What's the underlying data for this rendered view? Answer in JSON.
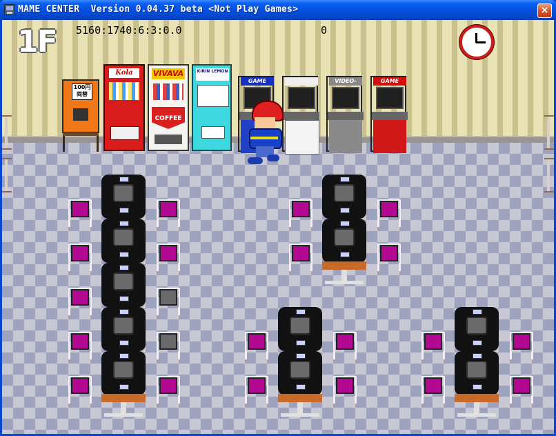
{
  "window": {
    "title": "MAME CENTER  Version 0.04.37 beta <Not Play Games>",
    "close_glyph": "×"
  },
  "hud": {
    "floor": "1F",
    "stats": "5160:1740:6:3:0.0",
    "score": "0"
  },
  "machines": {
    "coin_changer": {
      "price": "100円",
      "label": "両替"
    },
    "cola": {
      "brand": "Kola"
    },
    "vivava": {
      "brand": "VIVAVA",
      "sub": "COFFEE"
    },
    "kirin": {
      "brand": "KIRIN LEMON"
    },
    "arcade": [
      "GAME",
      "",
      "VIDEO-GAME",
      "GAME"
    ]
  },
  "colors": {
    "accent_titlebar": "#0a5ff0",
    "wall_light": "#e8e2b4",
    "wall_dark": "#c9c08e",
    "floor_light": "#c8c8d4",
    "floor_dark": "#9ea2bc",
    "chair_magenta": "#b00890"
  }
}
